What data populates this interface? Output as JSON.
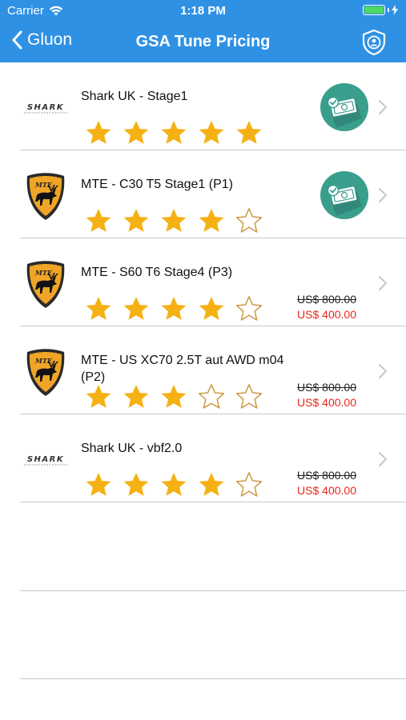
{
  "status_bar": {
    "carrier": "Carrier",
    "time": "1:18 PM",
    "icons": [
      "wifi-icon",
      "battery-icon",
      "charging-bolt-icon"
    ]
  },
  "nav": {
    "back_label": "Gluon",
    "title": "GSA Tune Pricing",
    "action_icon": "shield-user-icon"
  },
  "colors": {
    "nav_blue": "#2f91e4",
    "star_gold": "#f5b114",
    "discount_red": "#e8281c",
    "pay_badge": "#3a9e8d"
  },
  "tunes": [
    {
      "title": "Shark UK - Stage1",
      "brand_logo": "shark-logo",
      "rating": 5,
      "max_rating": 5,
      "payment": "paid-icon"
    },
    {
      "title": "MTE - C30 T5 Stage1 (P1)",
      "brand_logo": "mte-moose-logo",
      "rating": 4,
      "max_rating": 5,
      "payment": "paid-icon"
    },
    {
      "title": "MTE - S60 T6 Stage4 (P3)",
      "brand_logo": "mte-moose-logo",
      "rating": 4,
      "max_rating": 5,
      "old_price": "US$ 800.00",
      "new_price": "US$ 400.00"
    },
    {
      "title": "MTE - US XC70 2.5T aut AWD m04 (P2)",
      "brand_logo": "mte-moose-logo",
      "rating": 3,
      "max_rating": 5,
      "old_price": "US$ 800.00",
      "new_price": "US$ 400.00"
    },
    {
      "title": "Shark UK - vbf2.0",
      "brand_logo": "shark-logo",
      "rating": 4,
      "max_rating": 5,
      "old_price": "US$ 800.00",
      "new_price": "US$ 400.00"
    }
  ]
}
